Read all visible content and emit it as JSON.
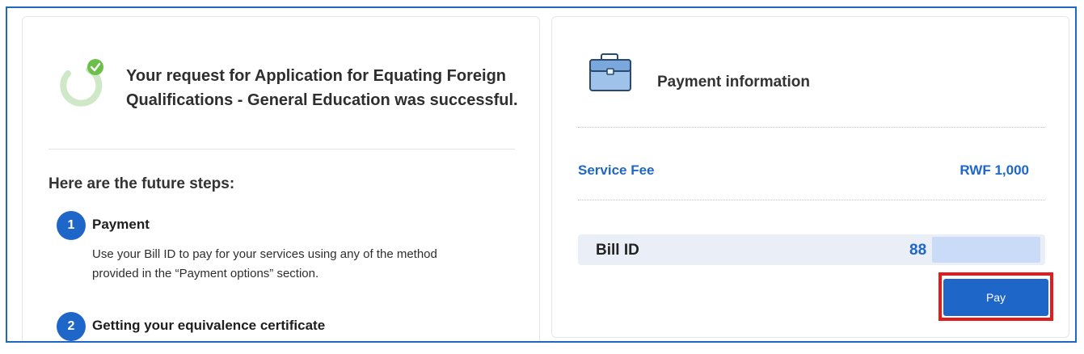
{
  "success": {
    "line1": "Your request for Application for Equating Foreign",
    "line2": "Qualifications - General Education was successful.",
    "icon": "success-check-icon"
  },
  "steps_heading": "Here are the future steps:",
  "steps": [
    {
      "number": "1",
      "title": "Payment",
      "desc_line1": "Use your Bill ID to pay for your services using any of the method",
      "desc_line2": "provided in the “Payment options” section."
    },
    {
      "number": "2",
      "title": "Getting your equivalence certificate"
    }
  ],
  "payment": {
    "title": "Payment information",
    "icon": "briefcase-icon",
    "service_fee_label": "Service Fee",
    "service_fee_value": "RWF 1,000",
    "bill_id_label": "Bill ID",
    "bill_id_value": "88",
    "pay_button": "Pay"
  },
  "colors": {
    "accent": "#1f66c9",
    "success": "#6cc04a",
    "highlight": "#e41b1b",
    "bill_bg": "#e9eef7"
  }
}
